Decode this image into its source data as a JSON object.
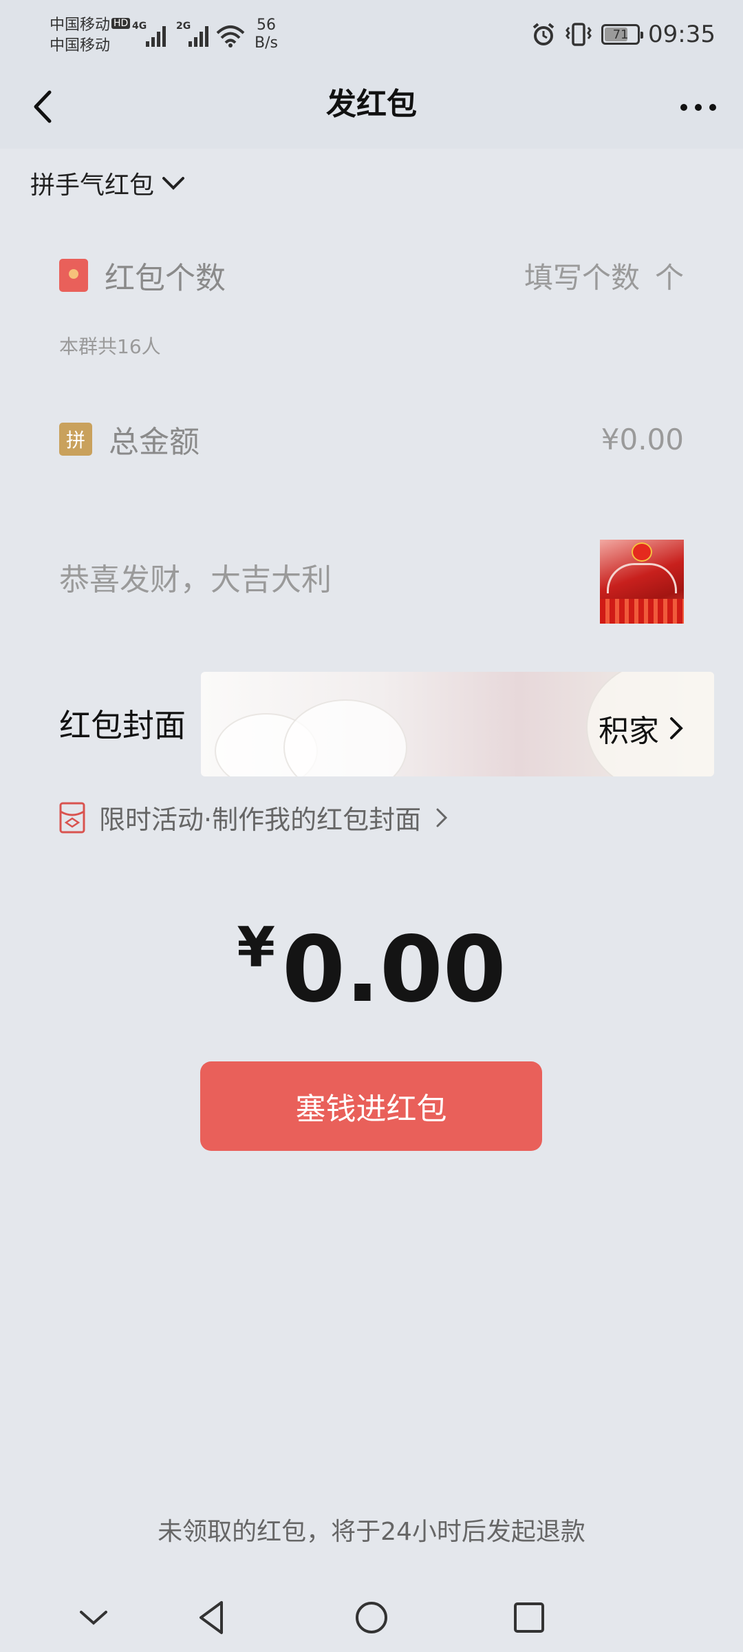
{
  "status_bar": {
    "carrier1": "中国移动",
    "hd_badge": "HD",
    "carrier2": "中国移动",
    "net1": "4G",
    "net2": "2G",
    "speed_value": "56",
    "speed_unit": "B/s",
    "battery": "71",
    "battery_level_percent": 71,
    "time": "09:35",
    "icons": [
      "alarm-icon",
      "vibrate-icon",
      "wifi-icon",
      "signal-icon"
    ]
  },
  "nav": {
    "title": "发红包",
    "back_icon": "chevron-left-icon",
    "more_icon": "more-dots-icon"
  },
  "packet_type": "拼手气红包",
  "count_row": {
    "label": "红包个数",
    "placeholder": "填写个数",
    "unit": "个",
    "hint": "本群共16人"
  },
  "amount_row": {
    "badge": "拼",
    "label": "总金额",
    "value": "¥0.00"
  },
  "blessing_placeholder": "恭喜发财，大吉大利",
  "cover": {
    "label": "红包封面",
    "selected_name": "积家"
  },
  "activity_link": "限时活动·制作我的红包封面",
  "total": {
    "currency": "¥",
    "value": "0.00"
  },
  "submit_label": "塞钱进红包",
  "refund_notice": "未领取的红包，将于24小时后发起退款",
  "colors": {
    "background": "#e4e7ec",
    "accent_red": "#e9605a",
    "badge_gold": "#c9a15c",
    "packet_red": "#e9605a"
  }
}
